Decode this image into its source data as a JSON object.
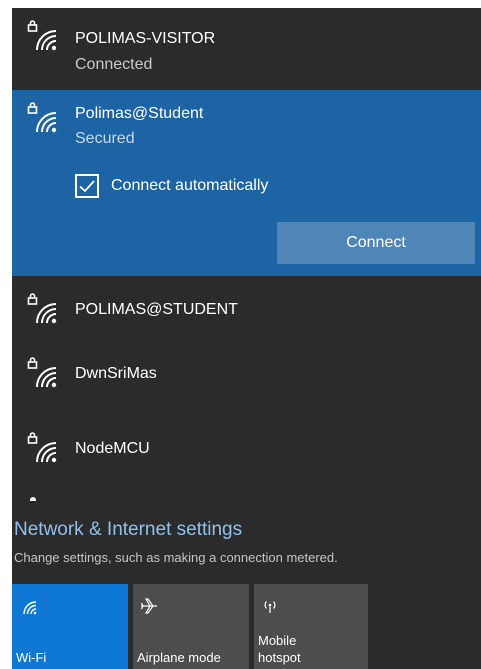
{
  "networks": [
    {
      "name": "POLIMAS-VISITOR",
      "status": "Connected",
      "icon": "wifi-secured-icon"
    },
    {
      "name": "Polimas@Student",
      "status": "Secured",
      "icon": "wifi-secured-icon"
    },
    {
      "name": "POLIMAS@STUDENT",
      "icon": "wifi-secured-icon"
    },
    {
      "name": "DwnSriMas",
      "icon": "wifi-secured-icon"
    },
    {
      "name": "NodeMCU",
      "icon": "wifi-secured-icon"
    }
  ],
  "selected": {
    "connect_automatically_label": "Connect automatically",
    "connect_automatically_checked": true,
    "connect_button_label": "Connect"
  },
  "settings": {
    "link_label": "Network & Internet settings",
    "description": "Change settings, such as making a connection metered."
  },
  "quick_actions": [
    {
      "label_line1": "Wi-Fi",
      "icon": "wifi-icon",
      "active": true
    },
    {
      "label_line1": "Airplane mode",
      "icon": "airplane-icon",
      "active": false
    },
    {
      "label_line1": "Mobile",
      "label_line2": "hotspot",
      "icon": "hotspot-icon",
      "active": false
    }
  ],
  "colors": {
    "panel_background": "#2b2b2b",
    "selected_background": "#1c64a4",
    "connect_button": "#4f86b8",
    "link_color": "#8ec1ef",
    "active_tile": "#0f78d4",
    "inactive_tile": "#4d4d4d"
  }
}
